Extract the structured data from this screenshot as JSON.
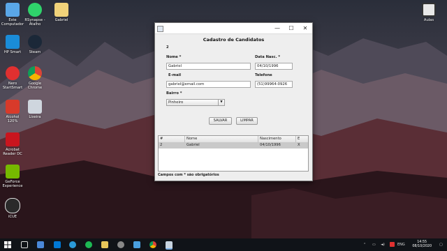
{
  "desktop": {
    "icons": [
      {
        "label": "Este\nComputador"
      },
      {
        "label": "RSynapse -\nAtalho"
      },
      {
        "label": "Gabriel"
      },
      {
        "label": "HP Smart"
      },
      {
        "label": "Steam"
      },
      {
        "label": "Nero\nStartSmart"
      },
      {
        "label": "Google\nChrome"
      },
      {
        "label": "Alcohol\n120%"
      },
      {
        "label": "Lixeira"
      },
      {
        "label": "Acrobat\nReader DC"
      },
      {
        "label": "GeForce\nExperience"
      },
      {
        "label": "iCUE"
      },
      {
        "label": "Aulas"
      }
    ]
  },
  "window": {
    "minimize": "—",
    "maximize": "☐",
    "close": "✕"
  },
  "form": {
    "title": "Cadastro de Candidatos",
    "id_value": "2",
    "nome_label": "Nome *",
    "nome_value": "Gabriel",
    "data_nasc_label": "Data Nasc. *",
    "data_nasc_value": "04/10/1996",
    "email_label": "E-mail",
    "email_value": "gabriel@email.com",
    "telefone_label": "Telefone",
    "telefone_value": "(51)99964-0926",
    "bairro_label": "Bairro *",
    "bairro_value": "Pinheiro",
    "salvar": "SALVAR",
    "limpar": "LIMPAR",
    "footer": "Campos com * são obrigatórios"
  },
  "table": {
    "columns": [
      "#",
      "Nome",
      "Nascimento",
      "E"
    ],
    "rows": [
      [
        "2",
        "Gabriel",
        "04/10/1996",
        "X"
      ]
    ]
  },
  "taskbar": {
    "lang": "ENG",
    "time": "14:55",
    "date": "08/10/2020"
  },
  "colors": {
    "taskbar": "#101318",
    "window_bg": "#eeeeee",
    "selected_row": "#c9c9c9"
  }
}
